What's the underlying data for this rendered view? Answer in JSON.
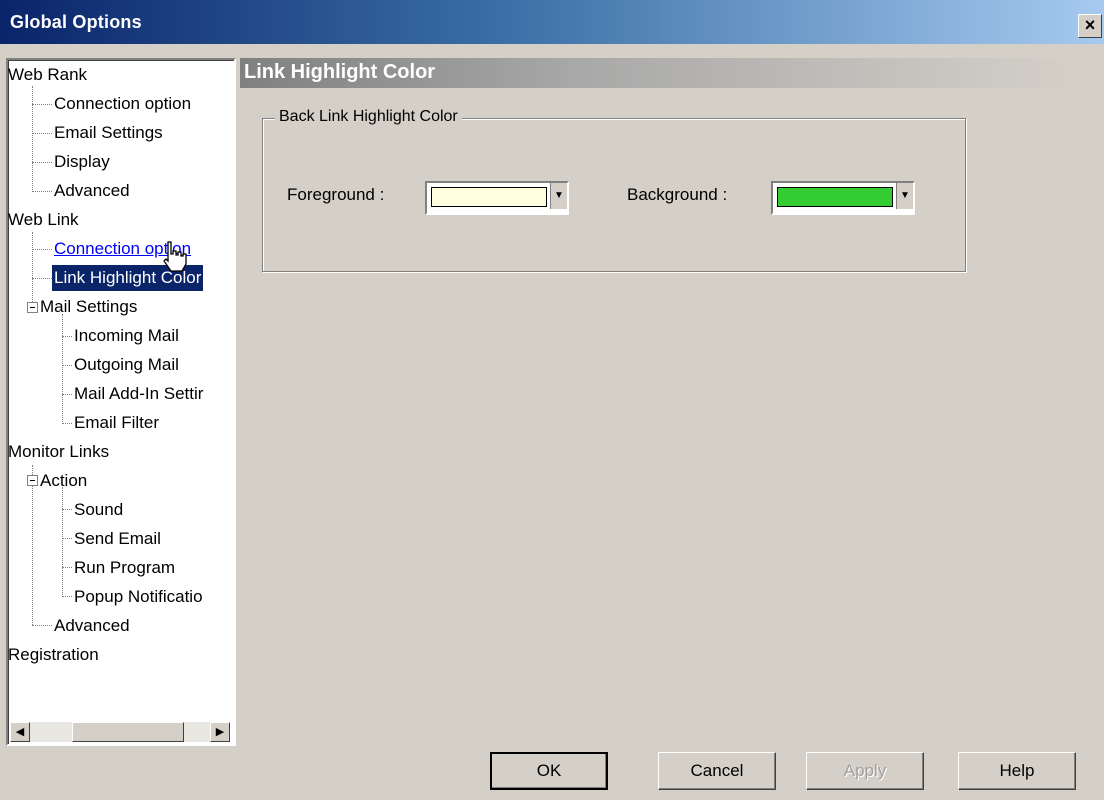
{
  "window": {
    "title": "Global Options",
    "close": "×"
  },
  "tree": {
    "items": [
      {
        "label": "Web Rank"
      },
      {
        "label": "Connection option"
      },
      {
        "label": "Email Settings"
      },
      {
        "label": "Display"
      },
      {
        "label": "Advanced"
      },
      {
        "label": "Web Link"
      },
      {
        "label": "Connection option"
      },
      {
        "label": "Link Highlight Color"
      },
      {
        "label": "Mail Settings"
      },
      {
        "label": "Incoming Mail"
      },
      {
        "label": "Outgoing Mail"
      },
      {
        "label": "Mail Add-In Settir"
      },
      {
        "label": "Email Filter"
      },
      {
        "label": "Monitor Links"
      },
      {
        "label": "Action"
      },
      {
        "label": "Sound"
      },
      {
        "label": "Send Email"
      },
      {
        "label": "Run Program"
      },
      {
        "label": "Popup Notificatio"
      },
      {
        "label": "Advanced"
      },
      {
        "label": "Registration"
      }
    ]
  },
  "panel": {
    "title": "Link Highlight Color",
    "group_label": "Back Link Highlight Color",
    "foreground_label": "Foreground :",
    "background_label": "Background :",
    "foreground_color": "#ffffe0",
    "background_color": "#33cc33"
  },
  "buttons": {
    "ok": "OK",
    "cancel": "Cancel",
    "apply": "Apply",
    "help": "Help"
  }
}
